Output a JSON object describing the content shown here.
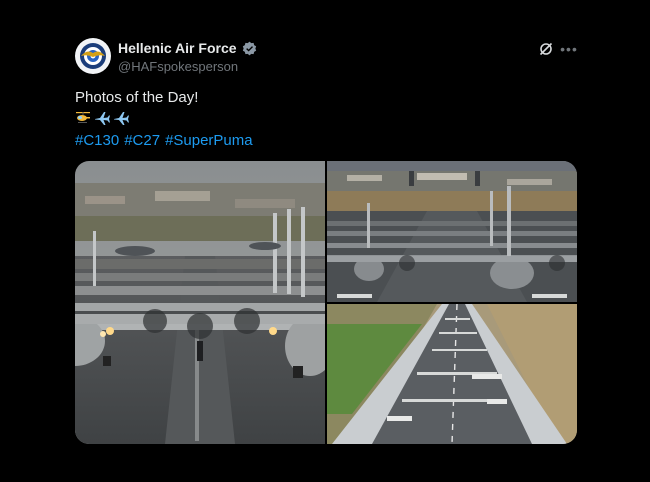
{
  "author": {
    "display_name": "Hellenic Air Force",
    "handle": "@HAFspokesperson",
    "verified": true,
    "avatar_icon": "haf-emblem-icon"
  },
  "post": {
    "text": "Photos of the Day!",
    "emojis": [
      "helicopter-icon",
      "airplane-icon",
      "airplane-icon"
    ],
    "hashtags": [
      "#C130",
      "#C27",
      "#SuperPuma"
    ]
  },
  "actions": {
    "grok_icon": "grok-icon",
    "more_icon": "more-icon"
  },
  "colors": {
    "background": "#000000",
    "text": "#e7e9ea",
    "secondary_text": "#71767b",
    "link": "#1d9bf0",
    "verified_badge": "#8b98a5"
  },
  "media": {
    "photos": [
      {
        "subject": "aircraft lined up on runway, close view"
      },
      {
        "subject": "aircraft formation taxiing"
      },
      {
        "subject": "aerial view of aircraft on runway"
      }
    ]
  }
}
